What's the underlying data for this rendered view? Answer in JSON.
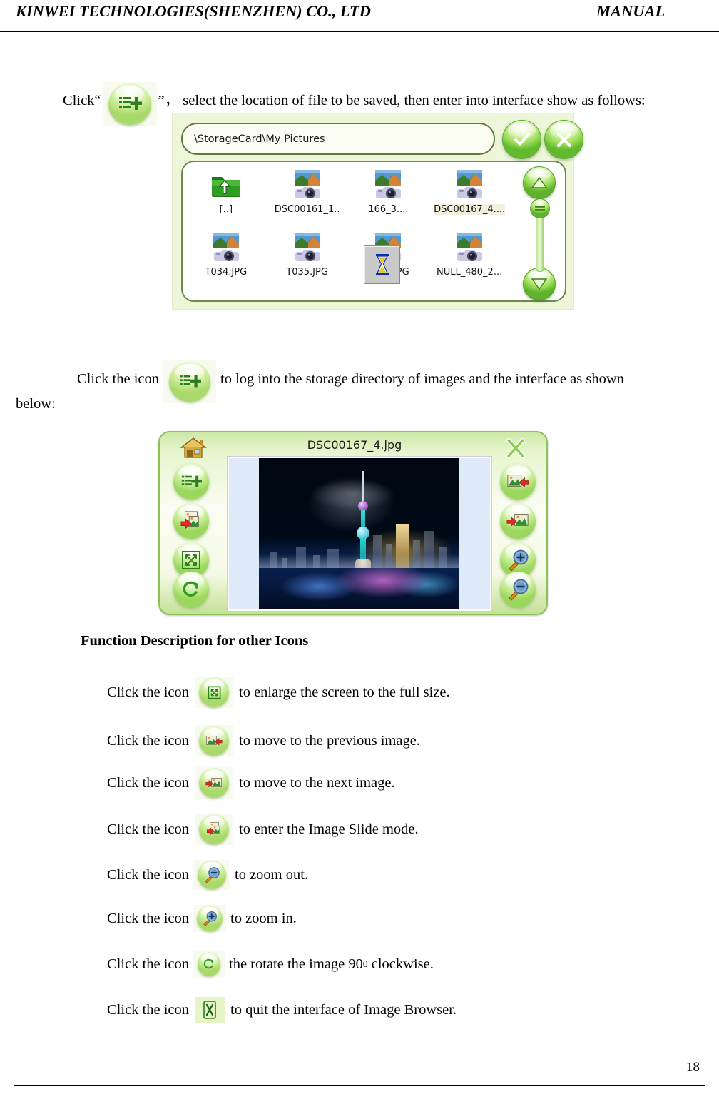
{
  "header": {
    "company": "KINWEI TECHNOLOGIES(SHENZHEN) CO., LTD",
    "doc_type": "MANUAL"
  },
  "footer": {
    "page_number": "18"
  },
  "paragraphs": {
    "intro_pre": "Click“",
    "intro_post": "”， select the location of file to be saved, then enter into interface show as follows:",
    "second_pre": "Click the icon",
    "second_post": "to log into the storage directory of images and the interface as shown",
    "second_tail": "below:"
  },
  "file_browser": {
    "path_value": "\\StorageCard\\My Pictures",
    "ok_button": "ok-check",
    "cancel_button": "cancel-x",
    "scroll_up": "scroll-up-arrow",
    "scroll_down": "scroll-down-arrow",
    "cursor": "hourglass-busy-cursor",
    "files": [
      {
        "label": "[..]",
        "type": "parent-folder"
      },
      {
        "label": "DSC00161_1..",
        "type": "image-file"
      },
      {
        "label": "166_3....",
        "type": "image-file"
      },
      {
        "label": "DSC00167_4....",
        "type": "image-file",
        "selected": true
      },
      {
        "label": "T034.JPG",
        "type": "image-file"
      },
      {
        "label": "T035.JPG",
        "type": "image-file"
      },
      {
        "label": "T130.JPG",
        "type": "image-file"
      },
      {
        "label": "NULL_480_2...",
        "type": "image-file"
      }
    ]
  },
  "image_viewer": {
    "title": "DSC00167_4.jpg",
    "home_icon": "home-icon",
    "close_icon": "close-x-icon",
    "left_buttons": [
      {
        "name": "file-list-add-icon"
      },
      {
        "name": "slideshow-icon"
      },
      {
        "name": "fullscreen-icon"
      },
      {
        "name": "rotate-clockwise-icon"
      }
    ],
    "right_buttons": [
      {
        "name": "previous-image-icon"
      },
      {
        "name": "next-image-icon"
      },
      {
        "name": "zoom-in-icon"
      },
      {
        "name": "zoom-out-icon"
      }
    ]
  },
  "function_list": {
    "heading": "Function Description for other Icons",
    "rows": [
      {
        "pre": "Click the icon",
        "icon": "fullscreen-icon",
        "post": "to enlarge the screen to the full size."
      },
      {
        "pre": "Click the icon",
        "icon": "previous-image-icon",
        "post": "to move to the previous image."
      },
      {
        "pre": "Click the icon",
        "icon": "next-image-icon",
        "post": "to move to the next image."
      },
      {
        "pre": "Click the icon",
        "icon": "slideshow-icon",
        "post": "to enter the Image Slide mode."
      },
      {
        "pre": "Click the icon",
        "icon": "zoom-out-icon",
        "post": "to zoom out."
      },
      {
        "pre": "Click the icon",
        "icon": "zoom-in-icon",
        "post": "to zoom in."
      },
      {
        "pre": "Click the icon",
        "icon": "rotate-clockwise-icon",
        "post_a": "the rotate the image 90",
        "sup": "0",
        "post_b": "clockwise."
      },
      {
        "pre": "Click the icon",
        "icon": "quit-x-icon",
        "post": "to quit the interface of Image Browser."
      }
    ]
  },
  "colors": {
    "panel_green": "#eef6da",
    "button_green": "#9ede5b",
    "border_green": "#5d7a3f",
    "selection_beige": "#f2efdc"
  }
}
